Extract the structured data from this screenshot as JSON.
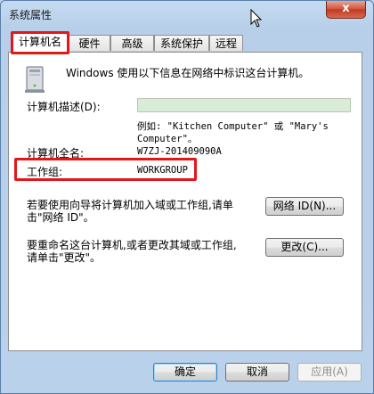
{
  "window": {
    "title": "系统属性",
    "close_label": "x"
  },
  "tabs": [
    {
      "label": "计算机名",
      "active": true
    },
    {
      "label": "硬件"
    },
    {
      "label": "高级"
    },
    {
      "label": "系统保护"
    },
    {
      "label": "远程"
    }
  ],
  "panel": {
    "intro": "Windows 使用以下信息在网络中标识这台计算机。",
    "desc_label": "计算机描述(D):",
    "desc_value": "",
    "example_line1": "例如: \"Kitchen Computer\" 或 \"Mary's",
    "example_line2": "Computer\"。",
    "fullname_label": "计算机全名:",
    "fullname_value": "W7ZJ-201409090A",
    "workgroup_label": "工作组:",
    "workgroup_value": "WORKGROUP",
    "network_text_line1": "若要使用向导将计算机加入域或工作组,请单",
    "network_text_line2": "击\"网络 ID\"。",
    "network_button": "网络 ID(N)...",
    "rename_text_line1": "要重命名这台计算机,或者更改其域或工作组,",
    "rename_text_line2": "请单击\"更改\"。",
    "change_button": "更改(C)..."
  },
  "footer": {
    "ok": "确定",
    "cancel": "取消",
    "apply": "应用(A)"
  },
  "colors": {
    "highlight": "#e3161a",
    "window_bg": "#b9d1ea"
  }
}
